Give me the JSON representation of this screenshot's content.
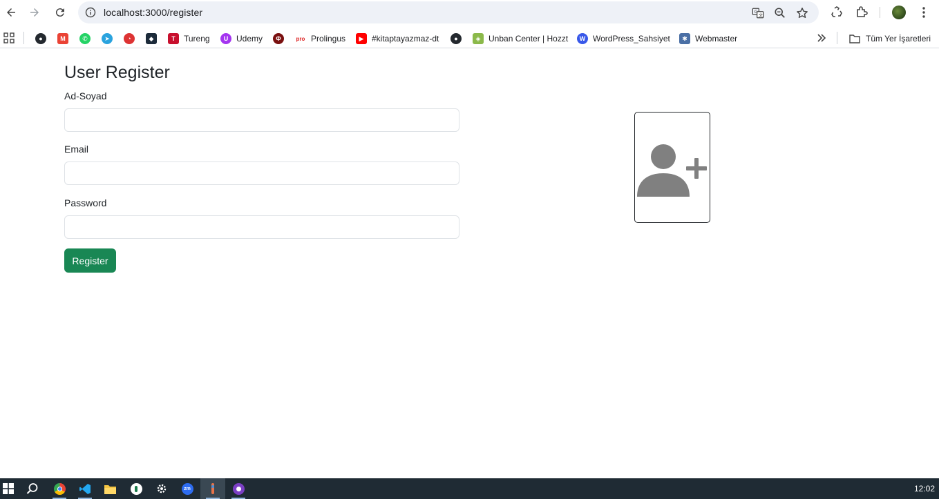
{
  "browser": {
    "url": "localhost:3000/register",
    "bookmarks": [
      {
        "label": "",
        "icon": "github-icon",
        "color": "#24292f"
      },
      {
        "label": "",
        "icon": "gmail-icon",
        "color": "#ea4335"
      },
      {
        "label": "",
        "icon": "whatsapp-icon",
        "color": "#25d366"
      },
      {
        "label": "",
        "icon": "telegram-icon",
        "color": "#2aa3de"
      },
      {
        "label": "",
        "icon": "speedometer-icon",
        "color": "#d33"
      },
      {
        "label": "",
        "icon": "code-icon",
        "color": "#1c2b3a"
      },
      {
        "label": "Tureng",
        "icon": "tureng-icon",
        "color": "#c8102e"
      },
      {
        "label": "Udemy",
        "icon": "udemy-icon",
        "color": "#a435f0"
      },
      {
        "label": "",
        "icon": "circle-logo-icon",
        "color": "#7a1010"
      },
      {
        "label": "Prolingus",
        "icon": "prolingus-icon",
        "color": "#d22"
      },
      {
        "label": "#kitaptayazmaz-dt",
        "icon": "youtube-icon",
        "color": "#ff0000"
      },
      {
        "label": "",
        "icon": "github-icon",
        "color": "#24292f"
      },
      {
        "label": "Unban Center | Hozzt",
        "icon": "cube-icon",
        "color": "#8bb94a"
      },
      {
        "label": "WordPress_Sahsiyet",
        "icon": "wordpress-icon",
        "color": "#3858e9"
      },
      {
        "label": "Webmaster",
        "icon": "gear-bird-icon",
        "color": "#4a6fa5"
      }
    ],
    "bookmarks_folder": "Tüm Yer İşaretleri"
  },
  "page": {
    "title": "User Register",
    "fields": [
      {
        "label": "Ad-Soyad",
        "value": "",
        "placeholder": ""
      },
      {
        "label": "Email",
        "value": "",
        "placeholder": ""
      },
      {
        "label": "Password",
        "value": "",
        "placeholder": ""
      }
    ],
    "submit_label": "Register",
    "avatar_icon": "user-plus-icon",
    "colors": {
      "primary_button": "#198754",
      "avatar_icon": "#808080"
    }
  },
  "taskbar": {
    "clock": "12:02",
    "apps": [
      "windows-start-icon",
      "search-icon",
      "chrome-icon",
      "vscode-icon",
      "file-explorer-icon",
      "app-icon",
      "settings-icon",
      "zoom-icon",
      "git-tool-icon",
      "github-desktop-icon"
    ]
  }
}
